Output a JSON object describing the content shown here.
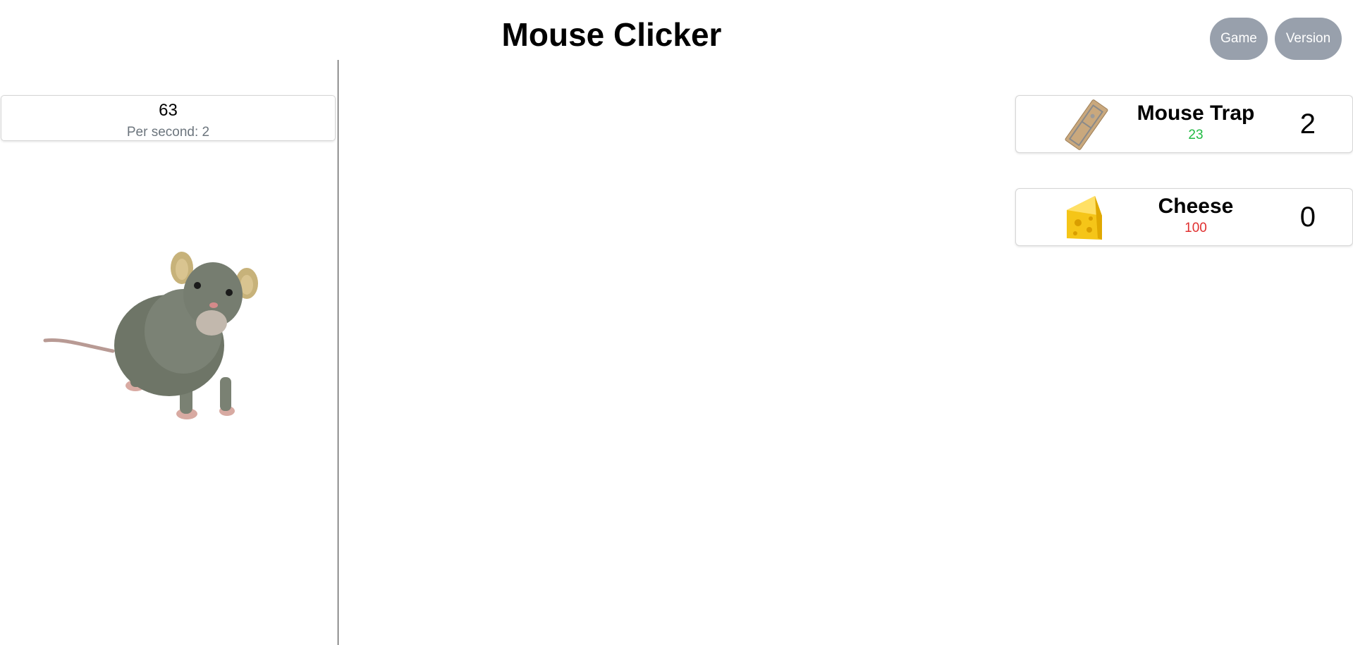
{
  "header": {
    "title": "Mouse Clicker",
    "buttons": {
      "game": "Game",
      "version": "Version"
    }
  },
  "counter": {
    "count": "63",
    "per_second_label": "Per second:",
    "per_second_value": "2"
  },
  "store": {
    "items": [
      {
        "name": "Mouse Trap",
        "cost": "23",
        "owned": "2",
        "cost_color": "#22bb44",
        "icon": "mouse-trap-icon"
      },
      {
        "name": "Cheese",
        "cost": "100",
        "owned": "0",
        "cost_color": "#e03030",
        "icon": "cheese-icon"
      }
    ]
  },
  "colors": {
    "button_bg": "#98a0ac",
    "affordable": "#22bb44",
    "unaffordable": "#e03030",
    "muted_text": "#6c757d"
  }
}
